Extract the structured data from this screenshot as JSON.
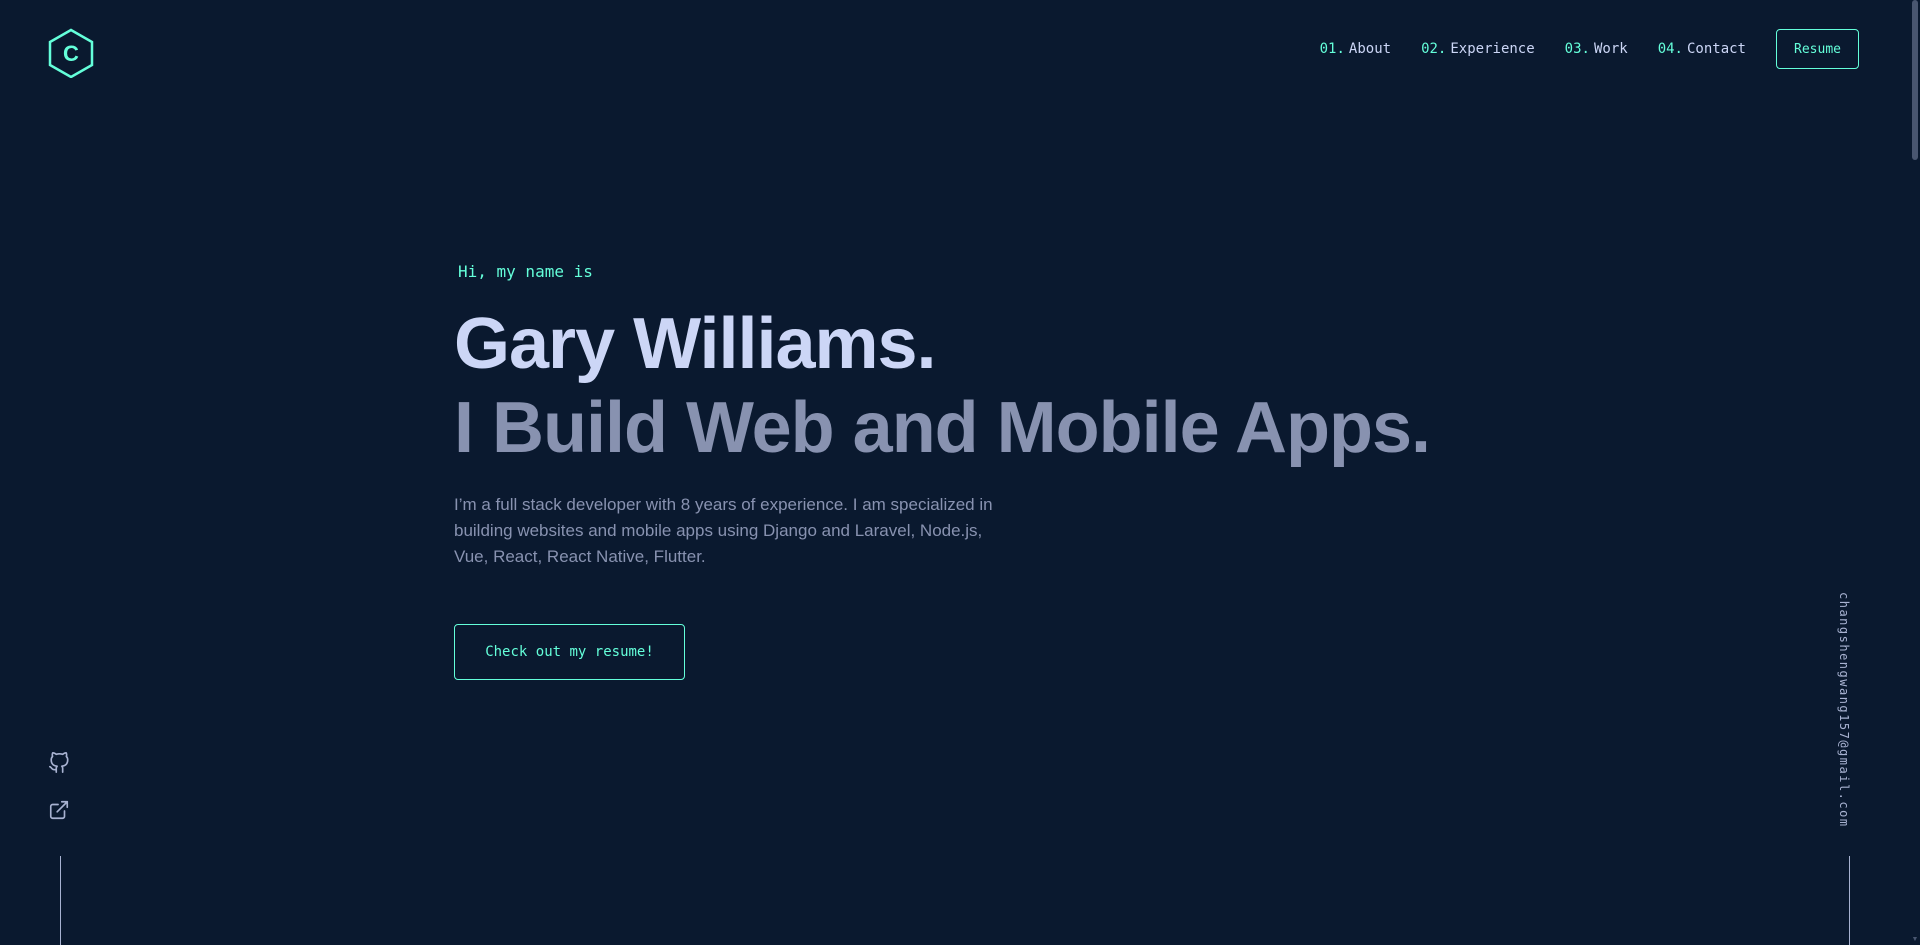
{
  "brand": {
    "logo_letter": "C",
    "accent_color": "#64ffda",
    "background_color": "#0a192f"
  },
  "nav": {
    "items": [
      {
        "number": "01.",
        "label": "About"
      },
      {
        "number": "02.",
        "label": "Experience"
      },
      {
        "number": "03.",
        "label": "Work"
      },
      {
        "number": "04.",
        "label": "Contact"
      }
    ],
    "resume_label": "Resume"
  },
  "hero": {
    "intro": "Hi, my name is",
    "name": "Gary Williams.",
    "tagline": "I Build Web and Mobile Apps.",
    "description": "I’m a full stack developer with 8 years of experience. I am specialized in building websites and mobile apps using Django and Laravel, Node.js, Vue, React, React Native, Flutter.",
    "cta_label": "Check out my resume!"
  },
  "social": {
    "links": [
      {
        "icon": "github-icon"
      },
      {
        "icon": "external-link-icon"
      }
    ]
  },
  "email": "changshengwang157@gmail.com"
}
